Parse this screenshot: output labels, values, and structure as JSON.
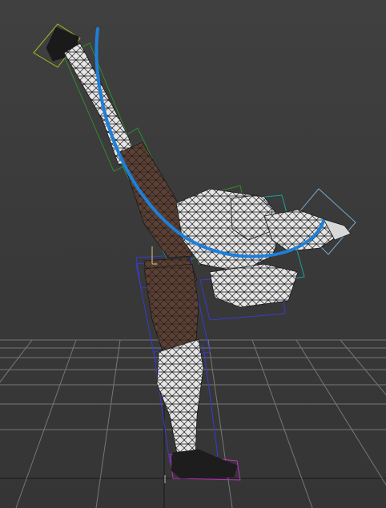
{
  "viewport": {
    "background": "#3a3a3a",
    "grid_color": "#6a6a6a",
    "axis_color": "#222222"
  },
  "scene": {
    "character": "figure-high-kick-wireframe",
    "mesh_fill": "#e8e8e8",
    "mesh_wire": "#1a1a1a",
    "skin_shading": "#5a4238",
    "curve_color": "#1e7fd8",
    "bone_colors": {
      "right_leg": "#2e8b2e",
      "torso": "#2e8b2e",
      "hips": "#3a3ad0",
      "left_leg": "#3a3ad0",
      "arms": "#1aa3a3",
      "foot": "#c02cc0",
      "kick_foot": "#a8b820"
    }
  }
}
